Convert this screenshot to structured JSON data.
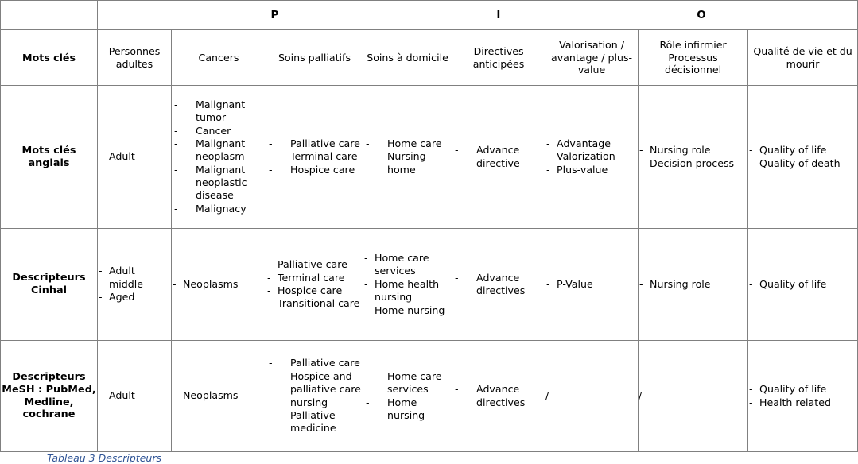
{
  "table": {
    "group_headers": [
      {
        "label": "",
        "span": 1
      },
      {
        "label": "P",
        "span": 4
      },
      {
        "label": "I",
        "span": 1
      },
      {
        "label": "O",
        "span": 3
      }
    ],
    "column_headers": [
      "Mots clés",
      "Personnes adultes",
      "Cancers",
      "Soins palliatifs",
      "Soins à domicile",
      "Directives anticipées",
      "Valorisation / avantage / plus-value",
      "Rôle infirmier Processus décisionnel",
      "Qualité de vie et du mourir"
    ],
    "rows": [
      {
        "label": "Mots clés anglais",
        "cells": [
          {
            "type": "list",
            "items": [
              "Malignant tumor",
              "Cancer",
              "Malignant neoplasm",
              "Malignant neoplastic disease",
              "Malignacy"
            ]
          },
          {
            "type": "list",
            "items": [
              "Adult"
            ]
          },
          {
            "type": "list",
            "items": [
              "Palliative care",
              "Terminal care",
              "Hospice care"
            ]
          },
          {
            "type": "list",
            "items": [
              "Home care",
              "Nursing home"
            ]
          },
          {
            "type": "list",
            "items": [
              "Advance directive"
            ]
          },
          {
            "type": "list",
            "items": [
              "Advantage",
              "Valorization",
              "Plus-value"
            ]
          },
          {
            "type": "list",
            "items": [
              "Nursing role",
              "Decision process"
            ]
          },
          {
            "type": "list",
            "items": [
              "Quality of life",
              "Quality of death"
            ]
          }
        ]
      },
      {
        "label": "Descripteurs Cinhal",
        "cells": [
          {
            "type": "list",
            "items": [
              "Neoplasms"
            ]
          },
          {
            "type": "list",
            "items": [
              "Adult middle",
              "Aged"
            ]
          },
          {
            "type": "list",
            "items": [
              "Palliative care",
              "Terminal care",
              "Hospice care",
              "Transitional care"
            ]
          },
          {
            "type": "list",
            "items": [
              "Home care services",
              "Home health nursing",
              "Home nursing"
            ]
          },
          {
            "type": "list",
            "items": [
              "Advance directives"
            ]
          },
          {
            "type": "list",
            "items": [
              "P-Value"
            ]
          },
          {
            "type": "list",
            "items": [
              "Nursing role"
            ]
          },
          {
            "type": "list",
            "items": [
              "Quality of life"
            ]
          }
        ]
      },
      {
        "label": "Descripteurs MeSH : PubMed, Medline, cochrane",
        "cells": [
          {
            "type": "list",
            "items": [
              "Adult"
            ]
          },
          {
            "type": "list",
            "items": [
              "Neoplasms"
            ]
          },
          {
            "type": "list",
            "items": [
              "Palliative care",
              "Hospice and palliative care nursing",
              "Palliative medicine"
            ]
          },
          {
            "type": "list",
            "items": [
              "Home care services",
              "Home nursing"
            ]
          },
          {
            "type": "list",
            "items": [
              "Advance directives"
            ]
          },
          {
            "type": "text",
            "value": "/"
          },
          {
            "type": "text",
            "value": "/"
          },
          {
            "type": "list",
            "items": [
              "Quality of life",
              "Health related"
            ]
          }
        ]
      }
    ]
  },
  "caption": {
    "text": "Tableau 3 Descripteurs"
  },
  "colors": {
    "border": "#808080",
    "caption": "#2e5395",
    "background": "#ffffff"
  }
}
